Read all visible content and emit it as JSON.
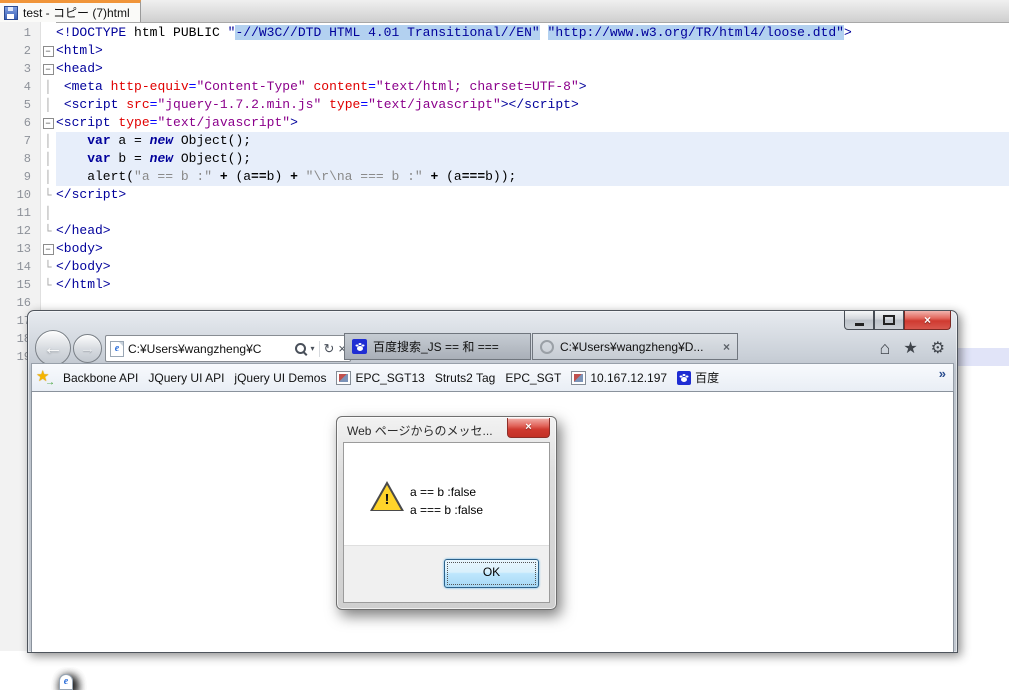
{
  "editor": {
    "tab_title": "test - コピー (7)html",
    "lines": [
      {
        "n": "1",
        "fold": "none",
        "tokens": [
          {
            "c": "tag",
            "t": "<!DOCTYPE"
          },
          {
            "c": "pln",
            "t": " html PUBLIC "
          },
          {
            "c": "tag",
            "t": "\""
          },
          {
            "c": "hlt",
            "t": "-//W3C//DTD HTML 4.01 Transitional//EN\""
          },
          {
            "c": "pln",
            "t": " "
          },
          {
            "c": "hlt",
            "t": "\"http://www.w3.org/TR/html4/loose.dtd\""
          },
          {
            "c": "tag",
            "t": ">"
          }
        ]
      },
      {
        "n": "2",
        "fold": "box",
        "tokens": [
          {
            "c": "tag",
            "t": "<html>"
          }
        ]
      },
      {
        "n": "3",
        "fold": "box",
        "tokens": [
          {
            "c": "tag",
            "t": "<head>"
          }
        ]
      },
      {
        "n": "4",
        "fold": "v",
        "tokens": [
          {
            "c": "pln",
            "t": " "
          },
          {
            "c": "tag",
            "t": "<meta"
          },
          {
            "c": "pln",
            "t": " "
          },
          {
            "c": "attr",
            "t": "http-equiv"
          },
          {
            "c": "pun",
            "t": "="
          },
          {
            "c": "val",
            "t": "\"Content-Type\""
          },
          {
            "c": "pln",
            "t": " "
          },
          {
            "c": "attr",
            "t": "content"
          },
          {
            "c": "pun",
            "t": "="
          },
          {
            "c": "val",
            "t": "\"text/html; charset=UTF-8\""
          },
          {
            "c": "tag",
            "t": ">"
          }
        ]
      },
      {
        "n": "5",
        "fold": "v",
        "tokens": [
          {
            "c": "pln",
            "t": " "
          },
          {
            "c": "tag",
            "t": "<script"
          },
          {
            "c": "pln",
            "t": " "
          },
          {
            "c": "attr",
            "t": "src"
          },
          {
            "c": "pun",
            "t": "="
          },
          {
            "c": "val",
            "t": "\"jquery-1.7.2.min.js\""
          },
          {
            "c": "pln",
            "t": " "
          },
          {
            "c": "attr",
            "t": "type"
          },
          {
            "c": "pun",
            "t": "="
          },
          {
            "c": "val",
            "t": "\"text/javascript\""
          },
          {
            "c": "tag",
            "t": "></script>"
          }
        ]
      },
      {
        "n": "6",
        "fold": "box",
        "tokens": [
          {
            "c": "tag",
            "t": "<script"
          },
          {
            "c": "pln",
            "t": " "
          },
          {
            "c": "attr",
            "t": "type"
          },
          {
            "c": "pun",
            "t": "="
          },
          {
            "c": "val",
            "t": "\"text/javascript\""
          },
          {
            "c": "tag",
            "t": ">"
          }
        ]
      },
      {
        "n": "7",
        "fold": "v",
        "sel": true,
        "tokens": [
          {
            "c": "pln",
            "t": "    "
          },
          {
            "c": "kw",
            "t": "var"
          },
          {
            "c": "pln",
            "t": " a = "
          },
          {
            "c": "kwi",
            "t": "new"
          },
          {
            "c": "pln",
            "t": " Object();"
          }
        ]
      },
      {
        "n": "8",
        "fold": "v",
        "sel": true,
        "tokens": [
          {
            "c": "pln",
            "t": "    "
          },
          {
            "c": "kw",
            "t": "var"
          },
          {
            "c": "pln",
            "t": " b = "
          },
          {
            "c": "kwi",
            "t": "new"
          },
          {
            "c": "pln",
            "t": " Object();"
          }
        ]
      },
      {
        "n": "9",
        "fold": "v",
        "sel": true,
        "tokens": [
          {
            "c": "pln",
            "t": "    alert("
          },
          {
            "c": "str",
            "t": "\"a == b :\""
          },
          {
            "c": "op",
            "t": " + "
          },
          {
            "c": "pln",
            "t": "(a"
          },
          {
            "c": "op",
            "t": "=="
          },
          {
            "c": "pln",
            "t": "b)"
          },
          {
            "c": "op",
            "t": " + "
          },
          {
            "c": "str",
            "t": "\"\\r\\na === b :\""
          },
          {
            "c": "op",
            "t": " + "
          },
          {
            "c": "pln",
            "t": "(a"
          },
          {
            "c": "op",
            "t": "==="
          },
          {
            "c": "pln",
            "t": "b));"
          }
        ]
      },
      {
        "n": "10",
        "fold": "end",
        "tokens": [
          {
            "c": "tag",
            "t": "</script>"
          }
        ]
      },
      {
        "n": "11",
        "fold": "v",
        "tokens": []
      },
      {
        "n": "12",
        "fold": "end",
        "tokens": [
          {
            "c": "tag",
            "t": "</head>"
          }
        ]
      },
      {
        "n": "13",
        "fold": "box",
        "tokens": [
          {
            "c": "tag",
            "t": "<body>"
          }
        ]
      },
      {
        "n": "14",
        "fold": "end",
        "tokens": [
          {
            "c": "tag",
            "t": "</body>"
          }
        ]
      },
      {
        "n": "15",
        "fold": "end",
        "tokens": [
          {
            "c": "tag",
            "t": "</html>"
          }
        ]
      },
      {
        "n": "16",
        "fold": "none",
        "tokens": []
      },
      {
        "n": "17",
        "fold": "none",
        "tokens": []
      },
      {
        "n": "18",
        "fold": "none",
        "tokens": []
      },
      {
        "n": "19",
        "fold": "none",
        "cur": true,
        "tokens": []
      }
    ]
  },
  "ie": {
    "window_buttons": [
      "minimize",
      "maximize",
      "close"
    ],
    "close_glyph": "×",
    "back_icon": "←",
    "forward_icon": "→",
    "address": {
      "url": "C:¥Users¥wangzheng¥C",
      "dropdown_icon": "▾",
      "refresh_icon": "↻",
      "stop_icon": "×"
    },
    "tabs": [
      {
        "icon": "baidu",
        "label": "百度搜索_JS == 和 ===",
        "active": false
      },
      {
        "icon": "loading",
        "label": "C:¥Users¥wangzheng¥D...",
        "close": "×",
        "active": true
      }
    ],
    "command_icons": {
      "home": "⌂",
      "favorites": "★",
      "settings": "⚙"
    },
    "favorites": {
      "overflow": "»",
      "items": [
        {
          "icon": "ie",
          "label": "Backbone API"
        },
        {
          "icon": "ie",
          "label": "JQuery UI API"
        },
        {
          "icon": "ie",
          "label": "jQuery UI Demos"
        },
        {
          "icon": "img",
          "label": "EPC_SGT13"
        },
        {
          "icon": "ie",
          "label": "Struts2 Tag"
        },
        {
          "icon": "ie",
          "label": "EPC_SGT"
        },
        {
          "icon": "img",
          "label": "10.167.12.197"
        },
        {
          "icon": "baidu",
          "label": "百度"
        }
      ]
    }
  },
  "dialog": {
    "title": "Web ページからのメッセ...",
    "close": "×",
    "messages": [
      "a == b :false",
      "a === b :false"
    ],
    "ok_label": "OK"
  },
  "colors": {
    "selection_bg": "#e7eefa",
    "find_highlight_bg": "#b3d1f0",
    "cursor_line_bg": "#e1e4f8",
    "tag": "#00009b",
    "attribute": "#e00000",
    "value": "#8b008b",
    "string": "#8a8a8a",
    "tab_accent_orange": "#f0953a",
    "close_button_red": "#cf3a30",
    "ok_focus_border": "#2c628b",
    "baidu_blue": "#1f2dd3"
  }
}
